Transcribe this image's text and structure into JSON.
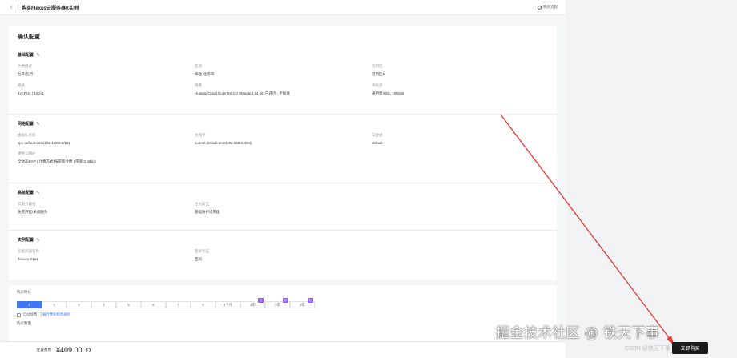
{
  "header": {
    "back_glyph": "‹",
    "title": "购买Flexus云服务器X实例",
    "help_label": "购买流程"
  },
  "config": {
    "title": "确认配置",
    "sections": [
      {
        "heading": "基础配置",
        "fields": [
          {
            "label": "计费模式",
            "value": "包年/包月"
          },
          {
            "label": "区域",
            "value": "华北-北京四"
          },
          {
            "label": "可用区",
            "value": "可用区1"
          },
          {
            "label": "规格",
            "value": "4vCPUs | 12GiB"
          },
          {
            "label": "镜像",
            "value": "Huawei Cloud EulerOS 2.0 Standard 64 bit, 已开启 , 不加速"
          },
          {
            "label": "系统盘",
            "value": "通用型SSD, 100GiB"
          }
        ]
      },
      {
        "heading": "网络配置",
        "fields": [
          {
            "label": "虚拟私有云",
            "value": "vpc-default-smb(192.168.0.0/16)"
          },
          {
            "label": "主网卡",
            "value": "subnet-default-smb(192.168.0.0/24)"
          },
          {
            "label": "安全组",
            "value": "default"
          },
          {
            "label": "弹性公网IP",
            "value": "全动态BGP | 计费方式 按带宽计费 | 带宽 3 Mbit/s"
          }
        ]
      },
      {
        "heading": "高级配置",
        "fields": [
          {
            "label": "云服务器组",
            "value": "免费开启/关闭服务"
          },
          {
            "label": "主机安全",
            "value": "基础防护试用版"
          }
        ]
      },
      {
        "heading": "实例配置",
        "fields": [
          {
            "label": "云服务器名称",
            "value": "flexusx-91a1"
          },
          {
            "label": "登录凭证",
            "value": "密码"
          }
        ]
      }
    ]
  },
  "purchase": {
    "duration_label": "购买时长",
    "durations": [
      "1",
      "2",
      "3",
      "4",
      "5",
      "6",
      "7",
      "8",
      "9个月",
      "1年",
      "2年",
      "3年"
    ],
    "discount_badge": "折",
    "auto_renew_label": "自动续费",
    "auto_renew_link": "了解计费和续费规则",
    "quantity_label": "购买数量"
  },
  "footer": {
    "fee_label": "配置费用",
    "price": "¥409.00",
    "help_glyph": "?",
    "buy_label": "立即购买"
  },
  "watermark": {
    "text": "掘金技术社区 @ 铁天下事",
    "sub": "CSDN @铁天下事"
  },
  "colors": {
    "accent": "#3f77f7",
    "badge": "#9a5bea",
    "arrow": "#e53935"
  }
}
